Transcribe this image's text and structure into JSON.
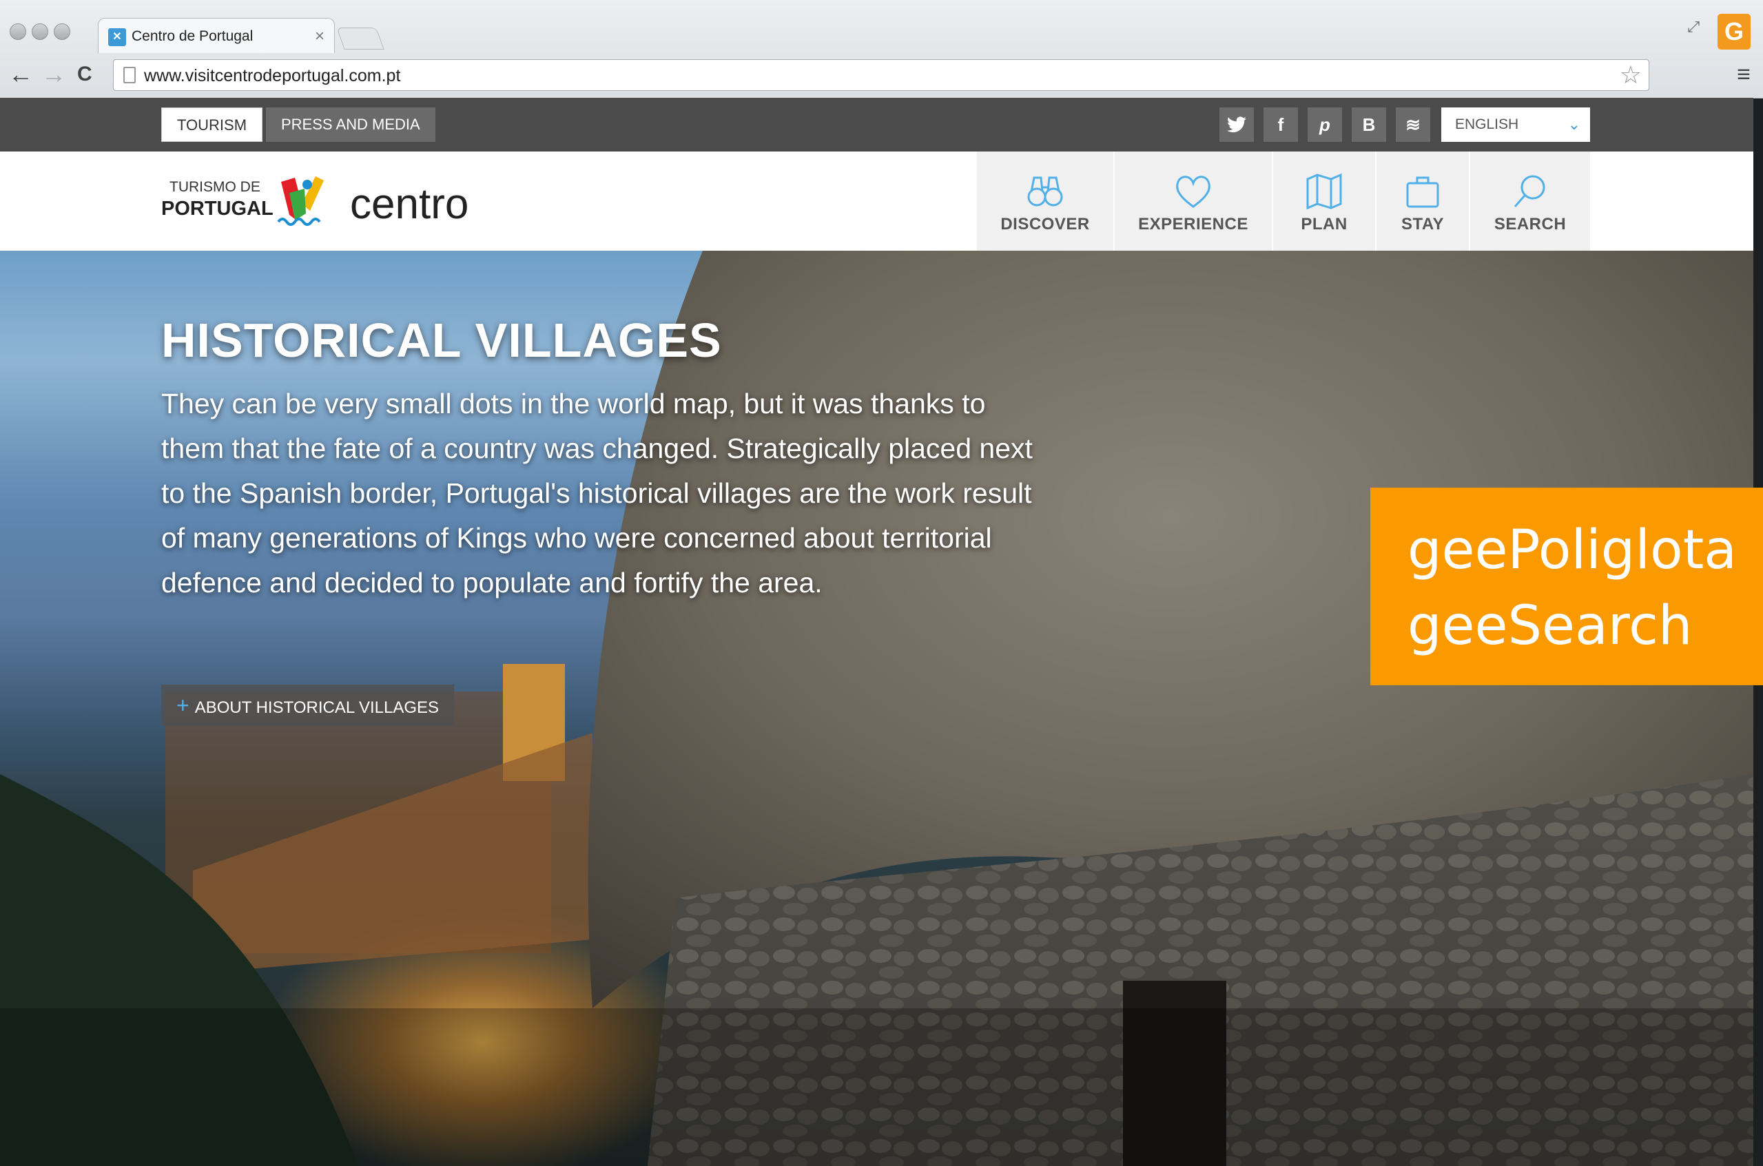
{
  "browser": {
    "tab_title": "Centro de Portugal",
    "tab_close": "×",
    "url": "www.visitcentrodeportugal.com.pt",
    "back": "←",
    "forward": "→",
    "reload": "C",
    "bookmark": "☆",
    "menu": "≡",
    "ext_label": "G",
    "resize_glyph": "⤢"
  },
  "topbar": {
    "tourism": "TOURISM",
    "press": "PRESS AND MEDIA",
    "social": [
      {
        "icon": "twitter-icon",
        "glyph": "🐦"
      },
      {
        "icon": "facebook-icon",
        "glyph": "f"
      },
      {
        "icon": "pinterest-icon",
        "glyph": "p"
      },
      {
        "icon": "blogger-icon",
        "glyph": "B"
      },
      {
        "icon": "rss-icon",
        "glyph": "≋"
      }
    ],
    "language": "ENGLISH",
    "language_chevron": "⌄"
  },
  "header": {
    "logo_line1": "TURISMO DE",
    "logo_line2": "PORTUGAL",
    "logo_wordmark": "centro",
    "nav": {
      "discover": "DISCOVER",
      "experience": "EXPERIENCE",
      "plan": "PLAN",
      "stay": "STAY",
      "search": "SEARCH"
    }
  },
  "hero": {
    "title": "HISTORICAL VILLAGES",
    "body": "They can be very small dots in the world map, but it was thanks to them that the fate of a country was changed. Strategically placed next to the Spanish border, Portugal's historical villages are the work result of many generations of Kings who were concerned about territorial defence and decided to populate and fortify the area.",
    "button_plus": "+",
    "button_label": "ABOUT HISTORICAL VILLAGES"
  },
  "promo": {
    "line1": "geePoliglota",
    "line2": "geeSearch"
  },
  "colors": {
    "accent_orange": "#fa9a00",
    "topbar_bg": "#4b4b4b",
    "link_blue": "#3a9ed8"
  }
}
